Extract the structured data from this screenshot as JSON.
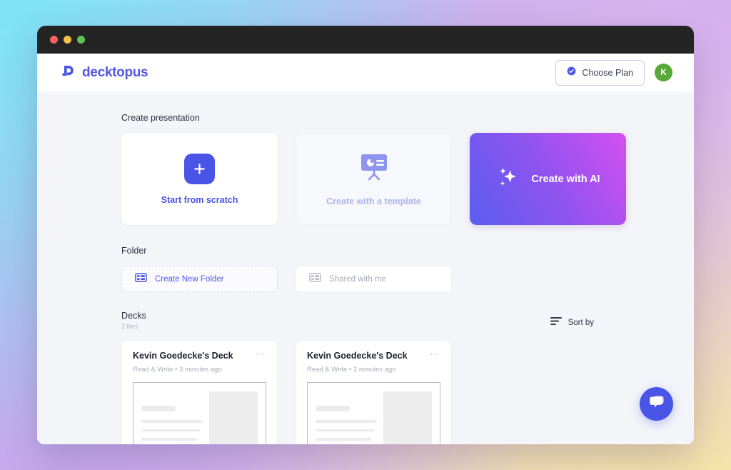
{
  "window": {
    "traffic_lights": [
      "close",
      "minimize",
      "maximize"
    ]
  },
  "header": {
    "brand_name": "decktopus",
    "brand_logo_icon": "decktopus-logo-icon",
    "choose_plan_label": "Choose Plan",
    "choose_plan_icon": "verified-badge-icon",
    "avatar_initial": "K",
    "avatar_color": "#5aa83a"
  },
  "create_presentation": {
    "section_title": "Create presentation",
    "cards": [
      {
        "label": "Start from scratch",
        "icon": "plus-icon",
        "state": "enabled"
      },
      {
        "label": "Create with a template",
        "icon": "presentation-board-icon",
        "state": "disabled"
      },
      {
        "label": "Create with AI",
        "icon": "sparkles-icon",
        "state": "enabled"
      }
    ]
  },
  "folder": {
    "section_title": "Folder",
    "items": [
      {
        "label": "Create New Folder",
        "icon": "layout-grid-icon",
        "style": "dashed"
      },
      {
        "label": "Shared with me",
        "icon": "layout-grid-icon",
        "style": "solid"
      }
    ]
  },
  "decks": {
    "section_title": "Decks",
    "file_count": "2 files",
    "sort_label": "Sort by",
    "sort_icon": "sort-lines-icon",
    "items": [
      {
        "name": "Kevin Goedecke's Deck",
        "permission": "Read & Write",
        "separator": "•",
        "modified": "3 minutes ago",
        "more_icon": "ellipsis-icon"
      },
      {
        "name": "Kevin Goedecke's Deck",
        "permission": "Read & Write",
        "separator": "•",
        "modified": "2 minutes ago",
        "more_icon": "ellipsis-icon"
      }
    ]
  },
  "chat_widget": {
    "icon": "chat-bubbles-icon",
    "color": "#4a55e8"
  },
  "colors": {
    "accent": "#4a55e8",
    "brand_text": "#5558e3",
    "ai_gradient_start": "#5a5ef0",
    "ai_gradient_end": "#d44ff0",
    "app_background": "#f4f5f8"
  }
}
